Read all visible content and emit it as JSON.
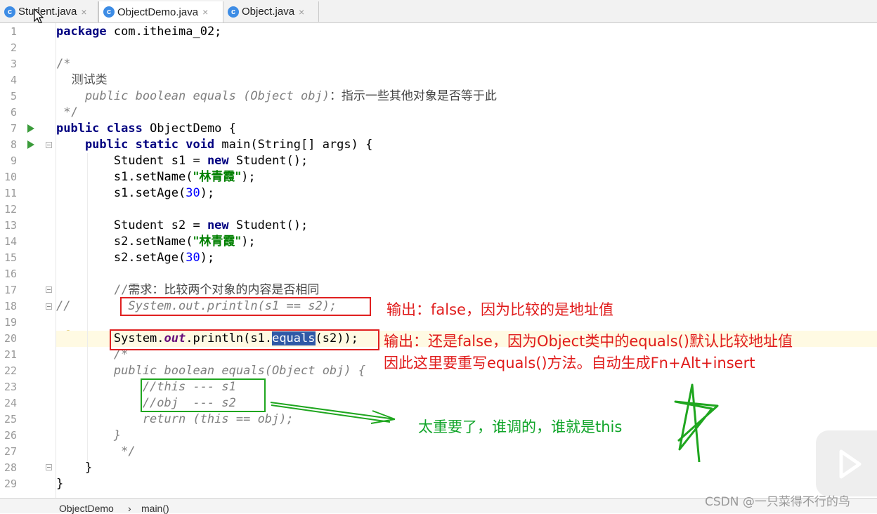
{
  "tabs": [
    {
      "label": "Student.java",
      "icon": "class-icon",
      "active": false
    },
    {
      "label": "ObjectDemo.java",
      "icon": "class-icon",
      "active": true
    },
    {
      "label": "Object.java",
      "icon": "class-icon",
      "active": false
    }
  ],
  "tab_icon_letter": "c",
  "tab_close_glyph": "×",
  "line_numbers": [
    "1",
    "2",
    "3",
    "4",
    "5",
    "6",
    "7",
    "8",
    "9",
    "10",
    "11",
    "12",
    "13",
    "14",
    "15",
    "16",
    "17",
    "18",
    "19",
    "20",
    "21",
    "22",
    "23",
    "24",
    "25",
    "26",
    "27",
    "28",
    "29"
  ],
  "code": {
    "l1_kw": "package",
    "l1_rest": " com.itheima_02;",
    "l3": "/*",
    "l4": "    测试类",
    "l5_sig": "    public boolean equals (Object obj)",
    "l5_desc": "：指示一些其他对象是否等于此",
    "l6": " */",
    "l7_kw": "public class",
    "l7_rest": " ObjectDemo {",
    "l8_kw": "    public static void",
    "l8_rest": " main(String[] args) {",
    "l9_a": "        Student s1 = ",
    "l9_kw": "new",
    "l9_b": " Student();",
    "l10_a": "        s1.setName(",
    "l10_str": "\"林青霞\"",
    "l10_b": ");",
    "l11_a": "        s1.setAge(",
    "l11_num": "30",
    "l11_b": ");",
    "l13_a": "        Student s2 = ",
    "l13_kw": "new",
    "l13_b": " Student();",
    "l14_a": "        s2.setName(",
    "l14_str": "\"林青霞\"",
    "l14_b": ");",
    "l15_a": "        s2.setAge(",
    "l15_num": "30",
    "l15_b": ");",
    "l17_a": "        //",
    "l17_b": "需求：比较两个对象的内容是否相同",
    "l18": "//        System.out.println(s1 == s2);",
    "l20_a": "        System.",
    "l20_field": "out",
    "l20_b": ".println(s1.",
    "l20_sel": "equals",
    "l20_c": "(s2));",
    "l21": "        /*",
    "l22": "        public boolean equals(Object obj) {",
    "l23": "            //this --- s1",
    "l24": "            //obj  --- s2",
    "l25": "            return (this == obj);",
    "l26": "        }",
    "l27": "         */",
    "l28": "    }",
    "l29": "}"
  },
  "annotations": {
    "note1": "输出：false，因为比较的是地址值",
    "note2_line1": "输出：还是false，因为Object类中的equals()默认比较地址值",
    "note2_line2": "因此这里要重写equals()方法。自动生成Fn+Alt+insert",
    "note3": "太重要了，谁调的，谁就是this"
  },
  "breadcrumb": {
    "class": "ObjectDemo",
    "separator": "›",
    "method": "main()"
  },
  "watermark": "CSDN @一只菜得不行的鸟",
  "colors": {
    "red": "#e01b1b",
    "green": "#11a52a",
    "selection": "#2f59a6"
  }
}
